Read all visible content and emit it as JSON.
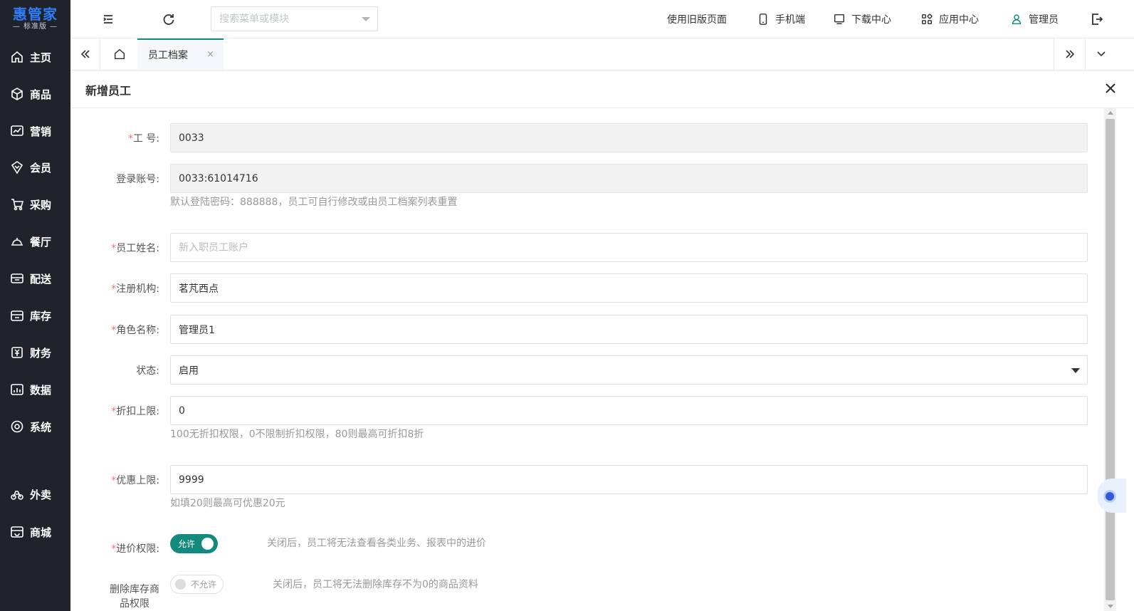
{
  "brand": {
    "name": "惠管家",
    "edition": "— 标准版 —",
    "color": "#2f7df6"
  },
  "sidebar": {
    "items": [
      {
        "label": "主页",
        "icon": "home-icon"
      },
      {
        "label": "商品",
        "icon": "box-icon"
      },
      {
        "label": "营销",
        "icon": "chart-line-icon"
      },
      {
        "label": "会员",
        "icon": "heart-shield-icon"
      },
      {
        "label": "采购",
        "icon": "cart-icon"
      },
      {
        "label": "餐厅",
        "icon": "cloche-icon"
      },
      {
        "label": "配送",
        "icon": "truck-icon"
      },
      {
        "label": "库存",
        "icon": "warehouse-icon"
      },
      {
        "label": "财务",
        "icon": "finance-icon"
      },
      {
        "label": "数据",
        "icon": "data-icon"
      },
      {
        "label": "系统",
        "icon": "settings-icon"
      },
      {
        "label": "外卖",
        "icon": "delivery-icon"
      },
      {
        "label": "商城",
        "icon": "store-icon"
      }
    ]
  },
  "topbar": {
    "search_placeholder": "搜索菜单或模块",
    "links": {
      "old_page": "使用旧版页面",
      "mobile": "手机端",
      "download": "下载中心",
      "apps": "应用中心",
      "user": "管理员"
    }
  },
  "tabs": {
    "active_label": "员工档案",
    "close_glyph": "×"
  },
  "dialog": {
    "title": "新增员工",
    "close_glyph": "✕"
  },
  "form": {
    "required_mark": "*",
    "employee_no": {
      "label": "工 号:",
      "value": "0033"
    },
    "login_account": {
      "label": "登录账号:",
      "value": "0033:61014716",
      "help": "默认登陆密码：888888，员工可自行修改或由员工档案列表重置"
    },
    "employee_name": {
      "label": "员工姓名:",
      "value": "",
      "placeholder": "新入职员工账户"
    },
    "org": {
      "label": "注册机构:",
      "value": "茗芃西点"
    },
    "role": {
      "label": "角色名称:",
      "value": "管理员1"
    },
    "status": {
      "label": "状态:",
      "value": "启用"
    },
    "discount_limit": {
      "label": "折扣上限:",
      "value": "0",
      "help": "100无折扣权限，0不限制折扣权限，80则最高可折扣8折"
    },
    "promo_limit": {
      "label": "优惠上限:",
      "value": "9999",
      "help": "如填20则最高可优惠20元"
    },
    "cost_permission": {
      "label": "进价权限:",
      "state": "允许",
      "on": true,
      "desc": "关闭后，员工将无法查看各类业务、报表中的进价"
    },
    "delete_stock_permission": {
      "label_line1": "删除库存商",
      "label_line2": "品权限",
      "state": "不允许",
      "on": false,
      "desc": "关闭后，员工将无法删除库存不为0的商品资料"
    }
  },
  "colors": {
    "accent": "#148a7c",
    "required": "#f56c6c",
    "sidebar_bg": "#20232a"
  }
}
